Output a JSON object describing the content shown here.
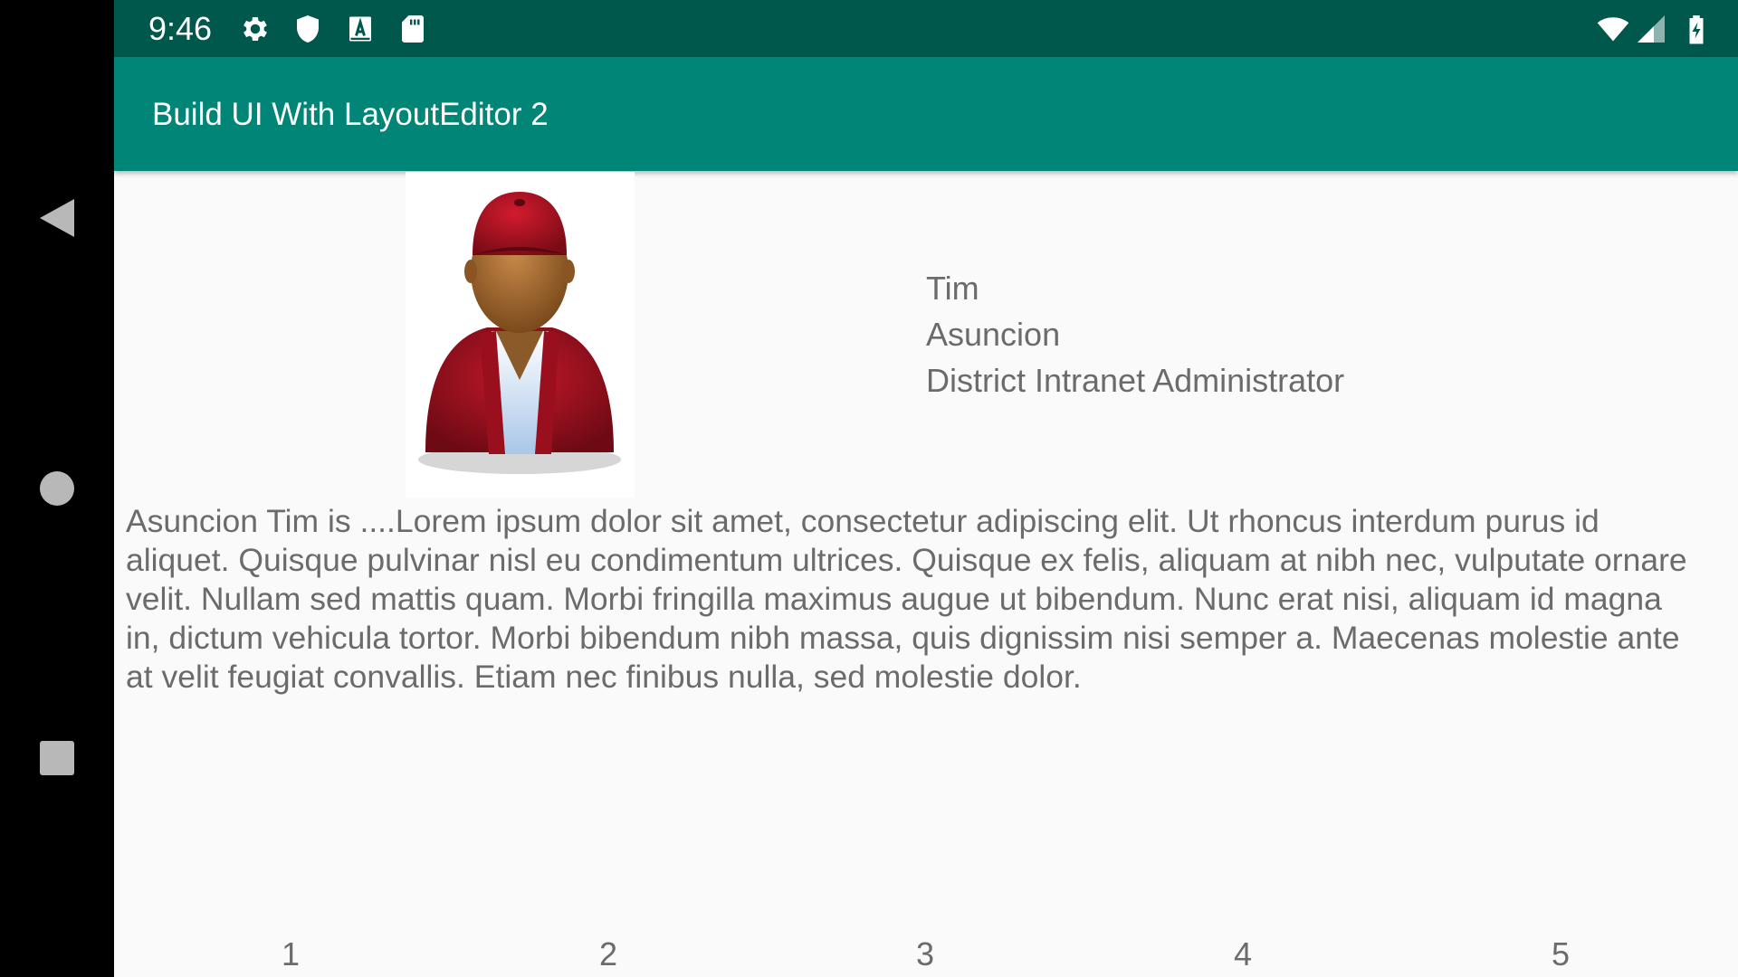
{
  "status_bar": {
    "time": "9:46",
    "left_icons": [
      "settings-icon",
      "shield-icon",
      "font-a-icon",
      "sd-card-icon"
    ],
    "right_icons": [
      "wifi-icon",
      "signal-icon",
      "battery-charging-icon"
    ],
    "background": "#00574b"
  },
  "nav_bar": {
    "buttons": [
      "back-icon",
      "home-icon",
      "recents-icon"
    ]
  },
  "app_bar": {
    "title": "Build UI With LayoutEditor 2",
    "background": "#008577"
  },
  "profile": {
    "first_name": "Tim",
    "last_name": "Asuncion",
    "role": "District Intranet Administrator",
    "bio": "Asuncion Tim is ....Lorem ipsum dolor sit amet, consectetur adipiscing elit. Ut rhoncus interdum purus id aliquet. Quisque pulvinar nisl eu condimentum ultrices. Quisque ex felis, aliquam at nibh nec, vulputate ornare velit. Nullam sed mattis quam. Morbi fringilla maximus augue ut bibendum. Nunc erat nisi, aliquam id magna in, dictum vehicula tortor. Morbi bibendum nibh massa, quis dignissim nisi semper a. Maecenas molestie ante at velit feugiat convallis. Etiam nec finibus nulla, sed molestie dolor."
  },
  "pager": {
    "pages": [
      "1",
      "2",
      "3",
      "4",
      "5"
    ]
  }
}
